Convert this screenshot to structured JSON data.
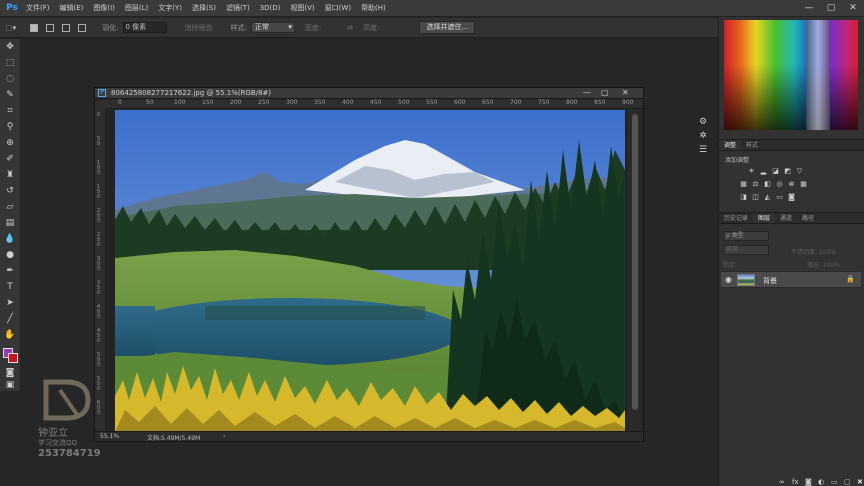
{
  "menu": {
    "logo": "Ps",
    "items": [
      "文件(F)",
      "编辑(E)",
      "图像(I)",
      "图层(L)",
      "文字(Y)",
      "选择(S)",
      "滤镜(T)",
      "3D(D)",
      "视图(V)",
      "窗口(W)",
      "帮助(H)"
    ],
    "window_controls": [
      "—",
      "▢",
      "✕"
    ]
  },
  "options": {
    "feather_label": "羽化:",
    "feather_value": "0 像素",
    "antialias_label": "消除锯齿",
    "style_label": "样式:",
    "style_value": "正常",
    "width_label": "宽度:",
    "height_label": "高度:",
    "select_mask_button": "选择并遮住..."
  },
  "toolbox": {
    "tools": [
      "move-icon",
      "marquee-icon",
      "lasso-icon",
      "quick-select-icon",
      "crop-icon",
      "eyedropper-icon",
      "healing-icon",
      "brush-icon",
      "stamp-icon",
      "history-brush-icon",
      "eraser-icon",
      "gradient-icon",
      "blur-icon",
      "dodge-icon",
      "pen-icon",
      "type-icon",
      "path-select-icon",
      "shape-icon",
      "hand-icon",
      "zoom-icon",
      "more-icon"
    ],
    "foreground_color": "#9a38b0",
    "background_color": "#c4161e"
  },
  "document": {
    "title": "806425808277217622.jpg @ 55.1%(RGB/8#)",
    "ruler_h": [
      "0",
      "50",
      "100",
      "150",
      "200",
      "250",
      "300",
      "350",
      "400",
      "450",
      "500",
      "550",
      "600",
      "650",
      "700",
      "750",
      "800",
      "850",
      "900"
    ],
    "ruler_v": [
      "0",
      "50",
      "100",
      "150",
      "200",
      "250",
      "300",
      "350",
      "400",
      "450",
      "500",
      "550",
      "600"
    ],
    "zoom": "55.1%",
    "doc_size": "文档:5.49M/5.49M"
  },
  "watermark": {
    "line1": "钟亚立",
    "line2": "学习交流QQ",
    "line3": "253784719"
  },
  "panels": {
    "adjust_tabs": [
      "调整",
      "样式"
    ],
    "adjust_title": "添加调整",
    "layer_tabs": [
      "历史记录",
      "图层",
      "通道",
      "路径"
    ],
    "filter_label": "ρ 类型",
    "blend_mode": "正常",
    "opacity_label": "不透明度: 100%",
    "fill_label": "填充: 100%",
    "lock_label": "锁定:",
    "layer_name": "背景"
  }
}
